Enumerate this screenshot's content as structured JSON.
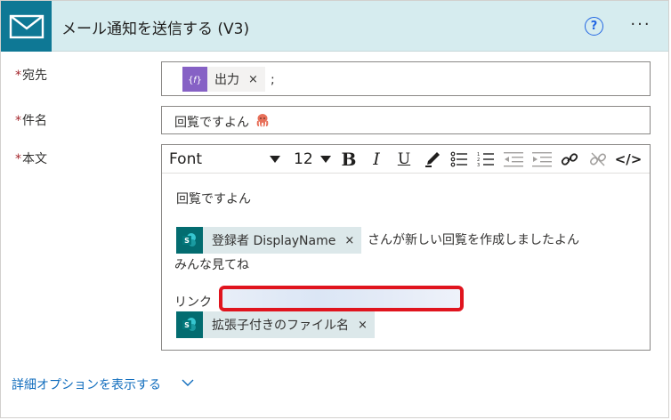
{
  "header": {
    "title": "メール通知を送信する (V3)",
    "help_label": "?",
    "more_label": "···"
  },
  "to": {
    "label": "宛先",
    "required_mark": "*",
    "token": {
      "label": "出力",
      "remove": "×",
      "icon": "expression-icon"
    },
    "suffix": ";"
  },
  "subject": {
    "label": "件名",
    "required_mark": "*",
    "value": "回覧ですよん",
    "emoji_icon": "octopus-icon"
  },
  "body": {
    "label": "本文",
    "required_mark": "*",
    "toolbar": {
      "font_name": "Font",
      "font_size": "12",
      "bold": "B",
      "italic": "I",
      "underline": "U",
      "code": "</>"
    },
    "line1": "回覧ですよん",
    "token_registrant": {
      "label": "登録者 DisplayName",
      "remove": "×",
      "icon": "sharepoint-icon"
    },
    "line2_suffix": "さんが新しい回覧を作成しましたよん",
    "line3": "みんな見てね",
    "link_label": "リンク",
    "token_filename": {
      "label": "拡張子付きのファイル名",
      "remove": "×",
      "icon": "sharepoint-icon"
    }
  },
  "advanced": {
    "label": "詳細オプションを表示する"
  },
  "colors": {
    "header_bg": "#d6ecef",
    "header_icon_bg": "#0e7895",
    "expression_chip": "#8661c5",
    "sharepoint_chip": "#036c70",
    "link": "#0f6cbd",
    "required": "#a4262c",
    "highlight": "#e0141e"
  }
}
